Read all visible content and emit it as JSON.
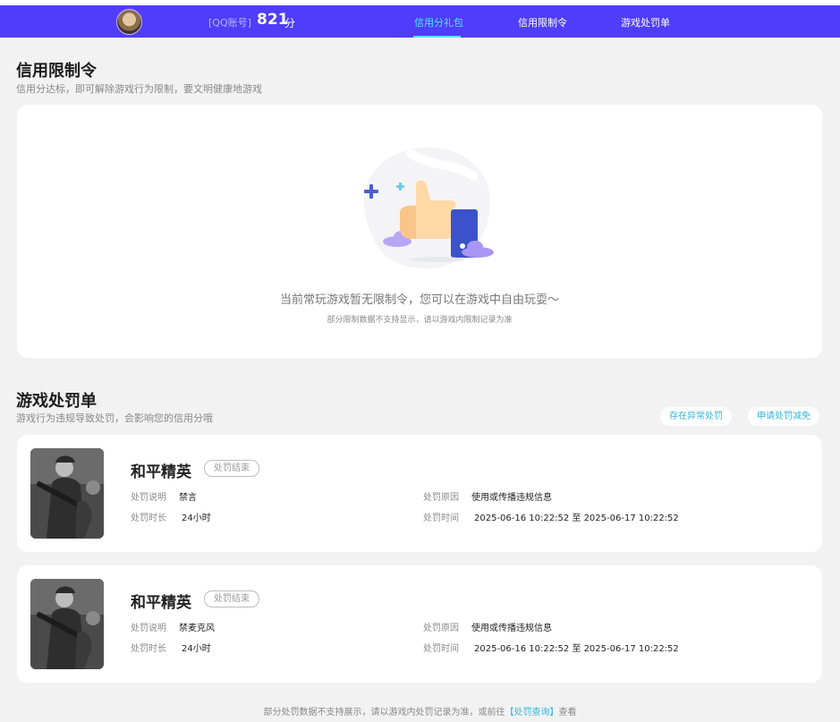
{
  "header": {
    "account_label": "[QQ账号]",
    "score": "821",
    "score_unit": "分",
    "tabs": [
      {
        "label": "信用分礼包",
        "active": true
      },
      {
        "label": "信用限制令",
        "active": false
      },
      {
        "label": "游戏处罚单",
        "active": false
      }
    ],
    "accent_color": "#4f3dfb",
    "active_tab_color": "#53e4ff"
  },
  "restriction": {
    "title": "信用限制令",
    "subtitle": "信用分达标，即可解除游戏行为限制，要文明健康地游戏",
    "empty_message": "当前常玩游戏暂无限制令，您可以在游戏中自由玩耍～",
    "empty_note": "部分限制数据不支持显示，请以游戏内限制记录为准",
    "illustration_icon": "thumbs-up-icon"
  },
  "penalty": {
    "title": "游戏处罚单",
    "subtitle": "游戏行为违规导致处罚，会影响您的信用分哦",
    "buttons": {
      "abnormal": "存在异常处罚",
      "reduce": "申请处罚减免"
    },
    "field_labels": {
      "desc": "处罚说明",
      "duration": "处罚时长",
      "reason": "处罚原因",
      "time": "处罚时间"
    },
    "records": [
      {
        "game": "和平精英",
        "status": "处罚结束",
        "desc": "禁言",
        "duration": "24小时",
        "reason": "使用或传播违规信息",
        "time": "2025-06-16 10:22:52 至 2025-06-17 10:22:52"
      },
      {
        "game": "和平精英",
        "status": "处罚结束",
        "desc": "禁麦克风",
        "duration": "24小时",
        "reason": "使用或传播违规信息",
        "time": "2025-06-16 10:22:52 至 2025-06-17 10:22:52"
      }
    ]
  },
  "footer": {
    "text_before": "部分处罚数据不支持展示，请以游戏内处罚记录为准，或前往",
    "link": "【处罚查询】",
    "text_after": "查看"
  }
}
